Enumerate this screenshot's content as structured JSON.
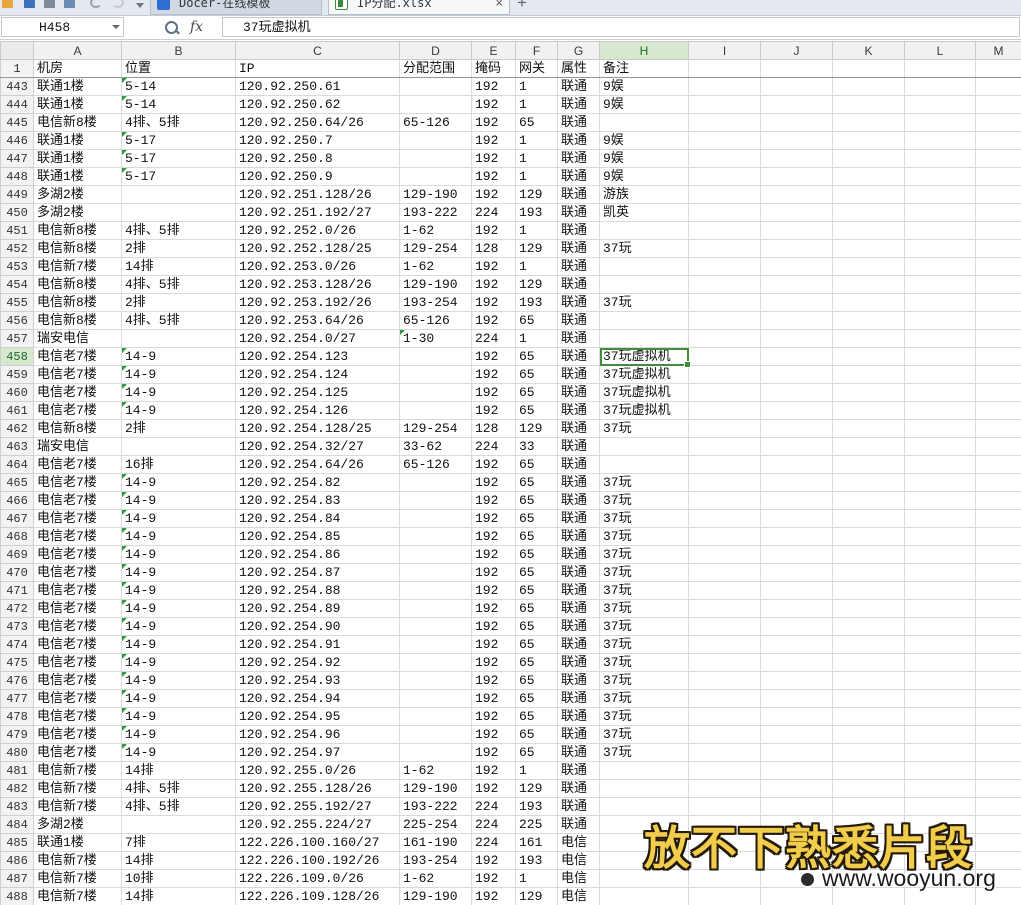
{
  "app": {
    "quick_access_icons": [
      "open-folder-icon",
      "save-icon",
      "print-icon",
      "print-preview-icon",
      "undo-icon",
      "redo-icon",
      "customize-dropdown-icon"
    ],
    "tabs": [
      {
        "label": "Docer-在线模板",
        "icon": "docer-icon",
        "active": false
      },
      {
        "label": "IP分配.xlsx",
        "icon": "spreadsheet-file-icon",
        "active": true
      }
    ],
    "close_tab_label": "×",
    "new_tab_label": "+"
  },
  "formula_bar": {
    "name_box": "H458",
    "fx_label": "fx",
    "formula": "37玩虚拟机"
  },
  "sheet": {
    "columns": [
      "A",
      "B",
      "C",
      "D",
      "E",
      "F",
      "G",
      "H",
      "I",
      "J",
      "K",
      "L",
      "M"
    ],
    "header_row": {
      "num": "1",
      "cells": [
        "机房",
        "位置",
        "IP",
        "分配范围",
        "掩码",
        "网关",
        "属性",
        "备注"
      ]
    },
    "rows": [
      {
        "num": "443",
        "cells": [
          "联通1楼",
          {
            "v": "5-14",
            "text_number": true
          },
          "120.92.250.61",
          "",
          "192",
          "1",
          "联通",
          "9娱"
        ]
      },
      {
        "num": "444",
        "cells": [
          "联通1楼",
          {
            "v": "5-14",
            "text_number": true
          },
          "120.92.250.62",
          "",
          "192",
          "1",
          "联通",
          "9娱"
        ]
      },
      {
        "num": "445",
        "cells": [
          "电信新8楼",
          "4排、5排",
          "120.92.250.64/26",
          "65-126",
          "192",
          "65",
          "联通",
          ""
        ]
      },
      {
        "num": "446",
        "cells": [
          "联通1楼",
          {
            "v": "5-17",
            "text_number": true
          },
          "120.92.250.7",
          "",
          "192",
          "1",
          "联通",
          "9娱"
        ]
      },
      {
        "num": "447",
        "cells": [
          "联通1楼",
          {
            "v": "5-17",
            "text_number": true
          },
          "120.92.250.8",
          "",
          "192",
          "1",
          "联通",
          "9娱"
        ]
      },
      {
        "num": "448",
        "cells": [
          "联通1楼",
          {
            "v": "5-17",
            "text_number": true
          },
          "120.92.250.9",
          "",
          "192",
          "1",
          "联通",
          "9娱"
        ]
      },
      {
        "num": "449",
        "cells": [
          "多湖2楼",
          "",
          "120.92.251.128/26",
          "129-190",
          "192",
          "129",
          "联通",
          "游族"
        ]
      },
      {
        "num": "450",
        "cells": [
          "多湖2楼",
          "",
          "120.92.251.192/27",
          "193-222",
          "224",
          "193",
          "联通",
          "凯英"
        ]
      },
      {
        "num": "451",
        "cells": [
          "电信新8楼",
          "4排、5排",
          "120.92.252.0/26",
          "1-62",
          "192",
          "1",
          "联通",
          ""
        ]
      },
      {
        "num": "452",
        "cells": [
          "电信新8楼",
          "2排",
          "120.92.252.128/25",
          "129-254",
          "128",
          "129",
          "联通",
          "37玩"
        ]
      },
      {
        "num": "453",
        "cells": [
          "电信新7楼",
          "14排",
          "120.92.253.0/26",
          "1-62",
          "192",
          "1",
          "联通",
          ""
        ]
      },
      {
        "num": "454",
        "cells": [
          "电信新8楼",
          "4排、5排",
          "120.92.253.128/26",
          "129-190",
          "192",
          "129",
          "联通",
          ""
        ]
      },
      {
        "num": "455",
        "cells": [
          "电信新8楼",
          "2排",
          "120.92.253.192/26",
          "193-254",
          "192",
          "193",
          "联通",
          "37玩"
        ]
      },
      {
        "num": "456",
        "cells": [
          "电信新8楼",
          "4排、5排",
          "120.92.253.64/26",
          "65-126",
          "192",
          "65",
          "联通",
          ""
        ]
      },
      {
        "num": "457",
        "cells": [
          "瑞安电信",
          "",
          "120.92.254.0/27",
          {
            "v": "1-30",
            "text_number": true
          },
          "224",
          "1",
          "联通",
          ""
        ]
      },
      {
        "num": "458",
        "cells": [
          "电信老7楼",
          {
            "v": "14-9",
            "text_number": true
          },
          "120.92.254.123",
          "",
          "192",
          "65",
          "联通",
          "37玩虚拟机"
        ]
      },
      {
        "num": "459",
        "cells": [
          "电信老7楼",
          {
            "v": "14-9",
            "text_number": true
          },
          "120.92.254.124",
          "",
          "192",
          "65",
          "联通",
          "37玩虚拟机"
        ]
      },
      {
        "num": "460",
        "cells": [
          "电信老7楼",
          {
            "v": "14-9",
            "text_number": true
          },
          "120.92.254.125",
          "",
          "192",
          "65",
          "联通",
          "37玩虚拟机"
        ]
      },
      {
        "num": "461",
        "cells": [
          "电信老7楼",
          {
            "v": "14-9",
            "text_number": true
          },
          "120.92.254.126",
          "",
          "192",
          "65",
          "联通",
          "37玩虚拟机"
        ]
      },
      {
        "num": "462",
        "cells": [
          "电信新8楼",
          "2排",
          "120.92.254.128/25",
          "129-254",
          "128",
          "129",
          "联通",
          "37玩"
        ]
      },
      {
        "num": "463",
        "cells": [
          "瑞安电信",
          "",
          "120.92.254.32/27",
          "33-62",
          "224",
          "33",
          "联通",
          ""
        ]
      },
      {
        "num": "464",
        "cells": [
          "电信老7楼",
          "16排",
          "120.92.254.64/26",
          "65-126",
          "192",
          "65",
          "联通",
          ""
        ]
      },
      {
        "num": "465",
        "cells": [
          "电信老7楼",
          {
            "v": "14-9",
            "text_number": true
          },
          "120.92.254.82",
          "",
          "192",
          "65",
          "联通",
          "37玩"
        ]
      },
      {
        "num": "466",
        "cells": [
          "电信老7楼",
          {
            "v": "14-9",
            "text_number": true
          },
          "120.92.254.83",
          "",
          "192",
          "65",
          "联通",
          "37玩"
        ]
      },
      {
        "num": "467",
        "cells": [
          "电信老7楼",
          {
            "v": "14-9",
            "text_number": true
          },
          "120.92.254.84",
          "",
          "192",
          "65",
          "联通",
          "37玩"
        ]
      },
      {
        "num": "468",
        "cells": [
          "电信老7楼",
          {
            "v": "14-9",
            "text_number": true
          },
          "120.92.254.85",
          "",
          "192",
          "65",
          "联通",
          "37玩"
        ]
      },
      {
        "num": "469",
        "cells": [
          "电信老7楼",
          {
            "v": "14-9",
            "text_number": true
          },
          "120.92.254.86",
          "",
          "192",
          "65",
          "联通",
          "37玩"
        ]
      },
      {
        "num": "470",
        "cells": [
          "电信老7楼",
          {
            "v": "14-9",
            "text_number": true
          },
          "120.92.254.87",
          "",
          "192",
          "65",
          "联通",
          "37玩"
        ]
      },
      {
        "num": "471",
        "cells": [
          "电信老7楼",
          {
            "v": "14-9",
            "text_number": true
          },
          "120.92.254.88",
          "",
          "192",
          "65",
          "联通",
          "37玩"
        ]
      },
      {
        "num": "472",
        "cells": [
          "电信老7楼",
          {
            "v": "14-9",
            "text_number": true
          },
          "120.92.254.89",
          "",
          "192",
          "65",
          "联通",
          "37玩"
        ]
      },
      {
        "num": "473",
        "cells": [
          "电信老7楼",
          {
            "v": "14-9",
            "text_number": true
          },
          "120.92.254.90",
          "",
          "192",
          "65",
          "联通",
          "37玩"
        ]
      },
      {
        "num": "474",
        "cells": [
          "电信老7楼",
          {
            "v": "14-9",
            "text_number": true
          },
          "120.92.254.91",
          "",
          "192",
          "65",
          "联通",
          "37玩"
        ]
      },
      {
        "num": "475",
        "cells": [
          "电信老7楼",
          {
            "v": "14-9",
            "text_number": true
          },
          "120.92.254.92",
          "",
          "192",
          "65",
          "联通",
          "37玩"
        ]
      },
      {
        "num": "476",
        "cells": [
          "电信老7楼",
          {
            "v": "14-9",
            "text_number": true
          },
          "120.92.254.93",
          "",
          "192",
          "65",
          "联通",
          "37玩"
        ]
      },
      {
        "num": "477",
        "cells": [
          "电信老7楼",
          {
            "v": "14-9",
            "text_number": true
          },
          "120.92.254.94",
          "",
          "192",
          "65",
          "联通",
          "37玩"
        ]
      },
      {
        "num": "478",
        "cells": [
          "电信老7楼",
          {
            "v": "14-9",
            "text_number": true
          },
          "120.92.254.95",
          "",
          "192",
          "65",
          "联通",
          "37玩"
        ]
      },
      {
        "num": "479",
        "cells": [
          "电信老7楼",
          {
            "v": "14-9",
            "text_number": true
          },
          "120.92.254.96",
          "",
          "192",
          "65",
          "联通",
          "37玩"
        ]
      },
      {
        "num": "480",
        "cells": [
          "电信老7楼",
          {
            "v": "14-9",
            "text_number": true
          },
          "120.92.254.97",
          "",
          "192",
          "65",
          "联通",
          "37玩"
        ]
      },
      {
        "num": "481",
        "cells": [
          "电信新7楼",
          "14排",
          "120.92.255.0/26",
          "1-62",
          "192",
          "1",
          "联通",
          ""
        ]
      },
      {
        "num": "482",
        "cells": [
          "电信新7楼",
          "4排、5排",
          "120.92.255.128/26",
          "129-190",
          "192",
          "129",
          "联通",
          ""
        ]
      },
      {
        "num": "483",
        "cells": [
          "电信新7楼",
          "4排、5排",
          "120.92.255.192/27",
          "193-222",
          "224",
          "193",
          "联通",
          ""
        ]
      },
      {
        "num": "484",
        "cells": [
          "多湖2楼",
          "",
          "120.92.255.224/27",
          "225-254",
          "224",
          "225",
          "联通",
          ""
        ]
      },
      {
        "num": "485",
        "cells": [
          "联通1楼",
          "7排",
          "122.226.100.160/27",
          "161-190",
          "224",
          "161",
          "电信",
          ""
        ]
      },
      {
        "num": "486",
        "cells": [
          "电信新7楼",
          "14排",
          "122.226.100.192/26",
          "193-254",
          "192",
          "193",
          "电信",
          ""
        ]
      },
      {
        "num": "487",
        "cells": [
          "电信新7楼",
          "10排",
          "122.226.109.0/26",
          "1-62",
          "192",
          "1",
          "电信",
          ""
        ]
      },
      {
        "num": "488",
        "cells": [
          "电信新7楼",
          "14排",
          "122.226.109.128/26",
          "129-190",
          "192",
          "129",
          "电信",
          ""
        ]
      }
    ]
  },
  "watermark": {
    "caption": "放不下熟悉片段",
    "site": "www.wooyun.org"
  },
  "colors": {
    "selection_border": "#3f8f3a",
    "header_highlight": "#d6e9ce",
    "text_number_marker": "#2a9a3a",
    "caption_fill": "#f2cc4b",
    "caption_outline": "#231a08"
  }
}
